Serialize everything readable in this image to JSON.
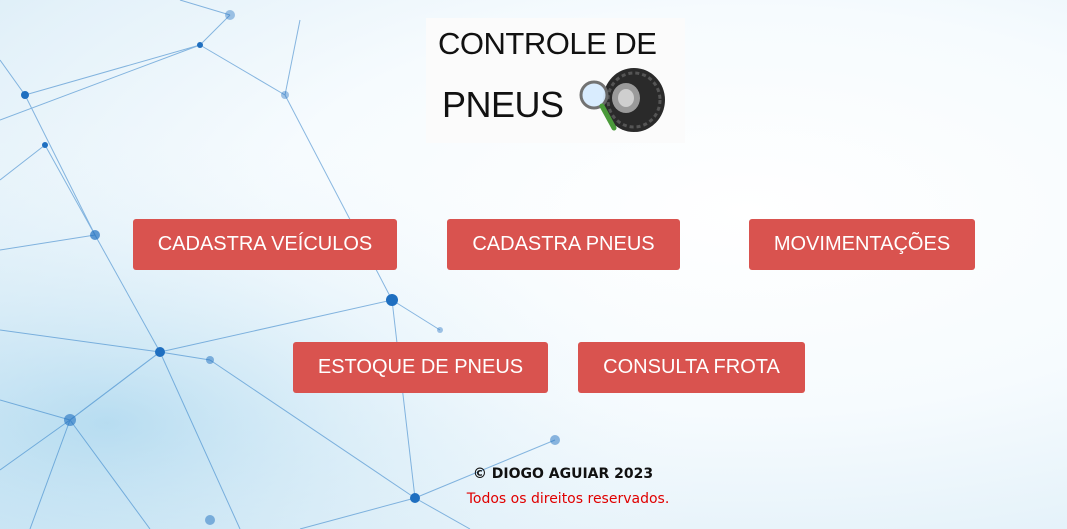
{
  "logo": {
    "line1": "CONTROLE DE",
    "line2": "PNEUS",
    "icon": "tire-magnifier-icon"
  },
  "buttons": [
    {
      "label": "CADASTRA VEÍCULOS"
    },
    {
      "label": "CADASTRA PNEUS"
    },
    {
      "label": "MOVIMENTAÇÕES"
    },
    {
      "label": "ESTOQUE DE PNEUS"
    },
    {
      "label": "CONSULTA FROTA"
    }
  ],
  "footer": {
    "copyright": "© DIOGO AGUIAR 2023",
    "rights": "Todos os direitos reservados."
  },
  "colors": {
    "button": "#d9534f",
    "button_text": "#ffffff",
    "rights_text": "#e00000"
  }
}
